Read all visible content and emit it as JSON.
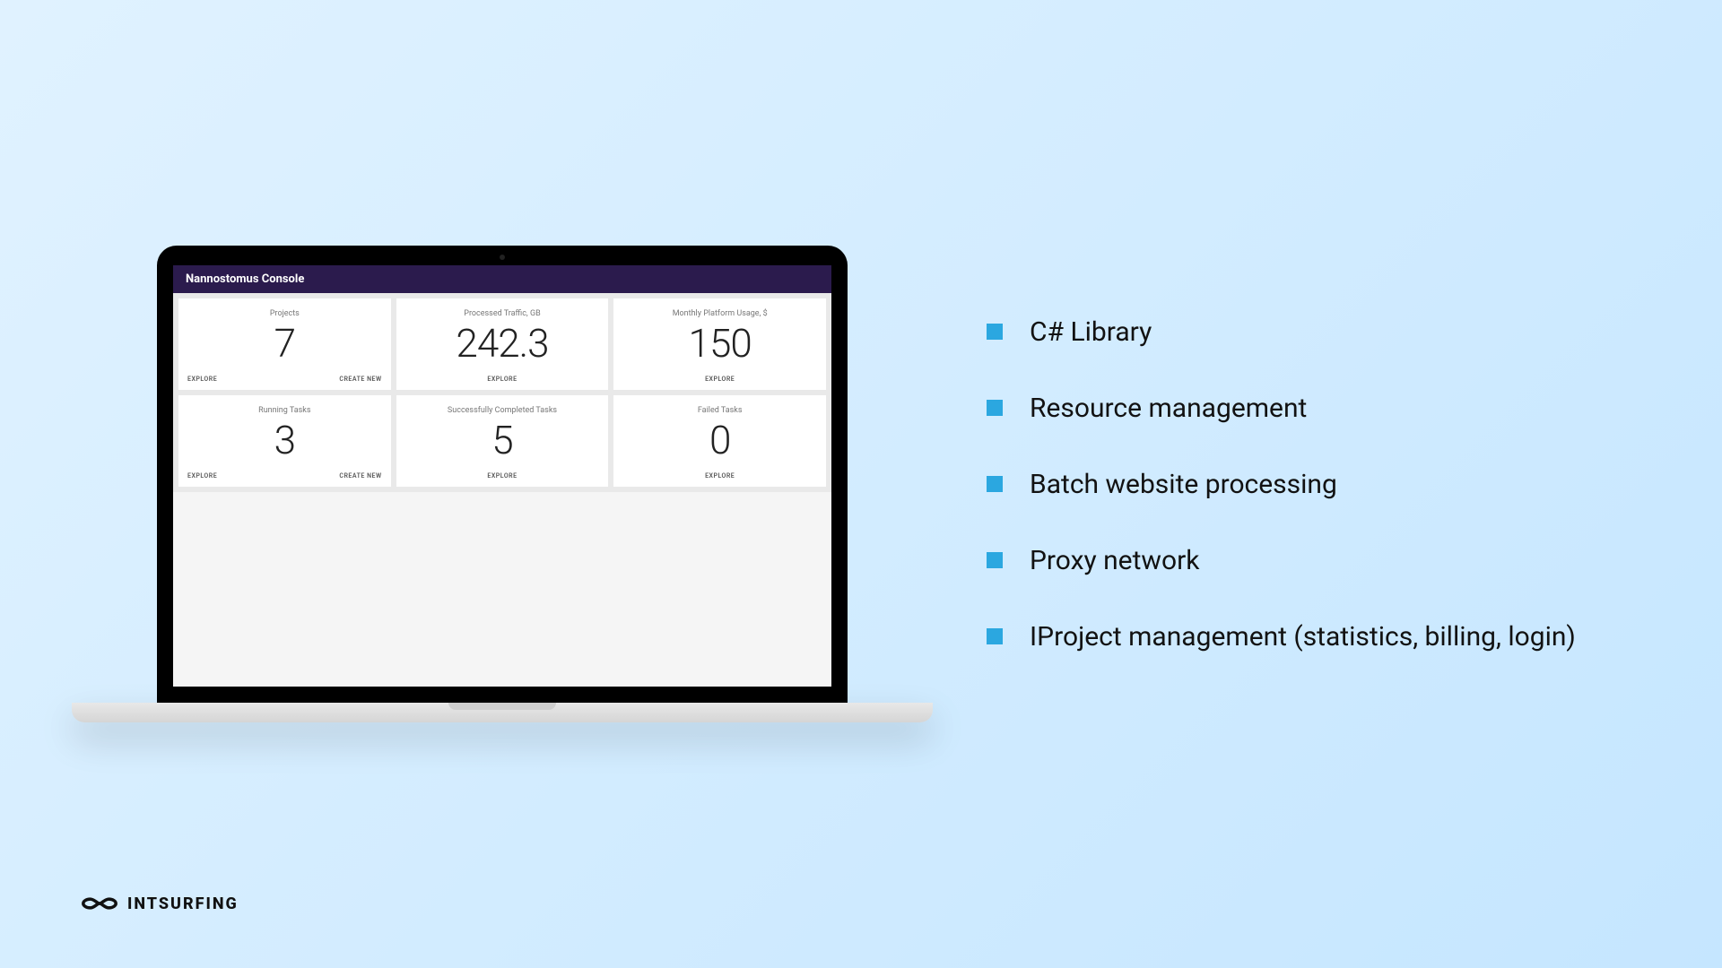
{
  "console": {
    "title": "Nannostomus Console",
    "cards": [
      {
        "label": "Projects",
        "value": "7",
        "explore": "EXPLORE",
        "create": "CREATE NEW"
      },
      {
        "label": "Processed Traffic, GB",
        "value": "242.3",
        "explore": "EXPLORE",
        "create": null
      },
      {
        "label": "Monthly Platform Usage, $",
        "value": "150",
        "explore": "EXPLORE",
        "create": null
      },
      {
        "label": "Running Tasks",
        "value": "3",
        "explore": "EXPLORE",
        "create": "CREATE NEW"
      },
      {
        "label": "Successfully Completed Tasks",
        "value": "5",
        "explore": "EXPLORE",
        "create": null
      },
      {
        "label": "Failed Tasks",
        "value": "0",
        "explore": "EXPLORE",
        "create": null
      }
    ]
  },
  "features": {
    "items": [
      "C# Library",
      "Resource management",
      "Batch website processing",
      "Proxy network",
      "IProject management (statistics, billing, login)"
    ]
  },
  "brand": {
    "name": "INTSURFING"
  },
  "colors": {
    "accent": "#2ba7e0",
    "headerBg": "#2b1b4d"
  }
}
